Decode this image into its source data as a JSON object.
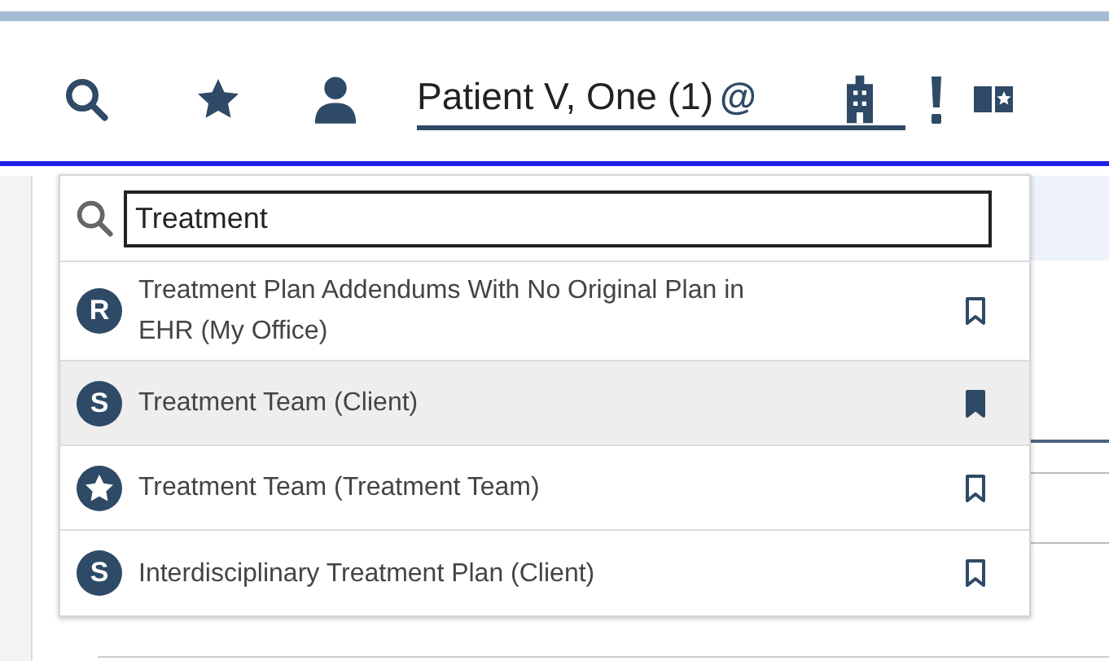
{
  "header": {
    "patient_name": "Patient V, One (1)",
    "at_sign": "@"
  },
  "search": {
    "value": "Treatment"
  },
  "results": [
    {
      "kind": "letter",
      "badge": "R",
      "label": "Treatment Plan Addendums With No Original Plan in EHR (My Office)",
      "selected": false,
      "bookmarked": false
    },
    {
      "kind": "letter",
      "badge": "S",
      "label": "Treatment Team (Client)",
      "selected": true,
      "bookmarked": true
    },
    {
      "kind": "star",
      "label": "Treatment Team (Treatment Team)",
      "selected": false,
      "bookmarked": false
    },
    {
      "kind": "letter",
      "badge": "S",
      "label": "Interdisciplinary Treatment Plan (Client)",
      "selected": false,
      "bookmarked": false
    }
  ]
}
